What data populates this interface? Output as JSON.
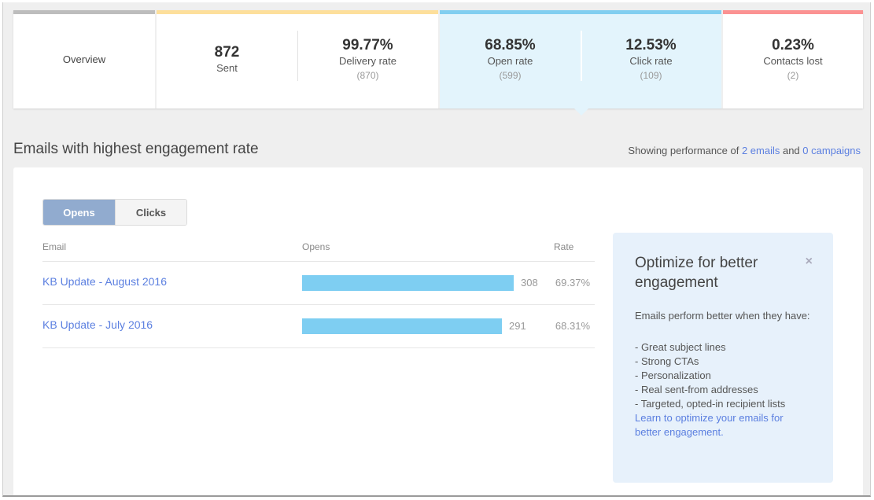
{
  "summary": {
    "overview_label": "Overview",
    "colors": {
      "overview": "#bdbdbd",
      "delivery": "#fddf9b",
      "engagement": "#81cef0",
      "lost": "#fb9292",
      "highlight_bg": "#e3f4fc"
    },
    "stats": [
      {
        "value": "872",
        "label": "Sent",
        "sub": ""
      },
      {
        "value": "99.77%",
        "label": "Delivery rate",
        "sub": "(870)"
      },
      {
        "value": "68.85%",
        "label": "Open rate",
        "sub": "(599)"
      },
      {
        "value": "12.53%",
        "label": "Click rate",
        "sub": "(109)"
      },
      {
        "value": "0.23%",
        "label": "Contacts lost",
        "sub": "(2)"
      }
    ]
  },
  "section": {
    "title": "Emails with highest engagement rate",
    "meta_prefix": "Showing performance of ",
    "emails_link": "2 emails",
    "meta_and": " and ",
    "campaigns_link": "0 campaigns"
  },
  "toggle": {
    "options": [
      "Opens",
      "Clicks"
    ],
    "selected": "Opens"
  },
  "table": {
    "columns": [
      "Email",
      "Opens",
      "Rate"
    ],
    "bar_color": "#7ecef2",
    "max_opens": 308,
    "rows": [
      {
        "email": "KB Update - August 2016",
        "opens": 308,
        "opens_label": "308",
        "rate": "69.37%"
      },
      {
        "email": "KB Update - July 2016",
        "opens": 291,
        "opens_label": "291",
        "rate": "68.31%"
      }
    ]
  },
  "tip": {
    "title": "Optimize for better engagement",
    "close_icon": "×",
    "intro": "Emails perform better when they have:",
    "items": [
      "- Great subject lines",
      "- Strong CTAs",
      "- Personalization",
      "- Real sent-from addresses",
      "- Targeted, opted-in recipient lists"
    ],
    "link_line1": "Learn to optimize your emails for",
    "link_line2": "better engagement."
  }
}
